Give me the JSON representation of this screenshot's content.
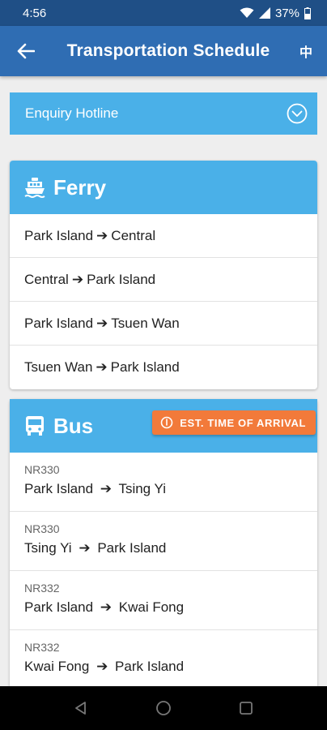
{
  "status_bar": {
    "time": "4:56",
    "battery": "37%",
    "icons": [
      "wifi-icon",
      "signal-icon",
      "battery-icon"
    ]
  },
  "app_bar": {
    "title": "Transportation Schedule",
    "language_label": "中",
    "back_icon": "arrow-left-icon"
  },
  "hotline": {
    "label": "Enquiry Hotline",
    "icon": "chevron-down-circle-icon"
  },
  "ferry": {
    "title": "Ferry",
    "icon": "ferry-icon",
    "routes": [
      {
        "from": "Park Island",
        "to": "Central"
      },
      {
        "from": "Central",
        "to": "Park Island"
      },
      {
        "from": "Park Island",
        "to": "Tsuen Wan"
      },
      {
        "from": "Tsuen Wan",
        "to": "Park Island"
      }
    ]
  },
  "bus": {
    "title": "Bus",
    "icon": "bus-icon",
    "eta_button": "EST. TIME OF ARRIVAL",
    "routes": [
      {
        "number": "NR330",
        "from": "Park Island",
        "to": "Tsing Yi"
      },
      {
        "number": "NR330",
        "from": "Tsing Yi",
        "to": "Park Island"
      },
      {
        "number": "NR332",
        "from": "Park Island",
        "to": "Kwai Fong"
      },
      {
        "number": "NR332",
        "from": "Kwai Fong",
        "to": "Park Island"
      }
    ]
  },
  "colors": {
    "status_bar": "#1f4f86",
    "app_bar": "#2f6db3",
    "accent": "#4ab0e8",
    "eta": "#f27a3a"
  },
  "nav_bar": {
    "icons": [
      "back-triangle-icon",
      "home-circle-icon",
      "recents-square-icon"
    ]
  }
}
